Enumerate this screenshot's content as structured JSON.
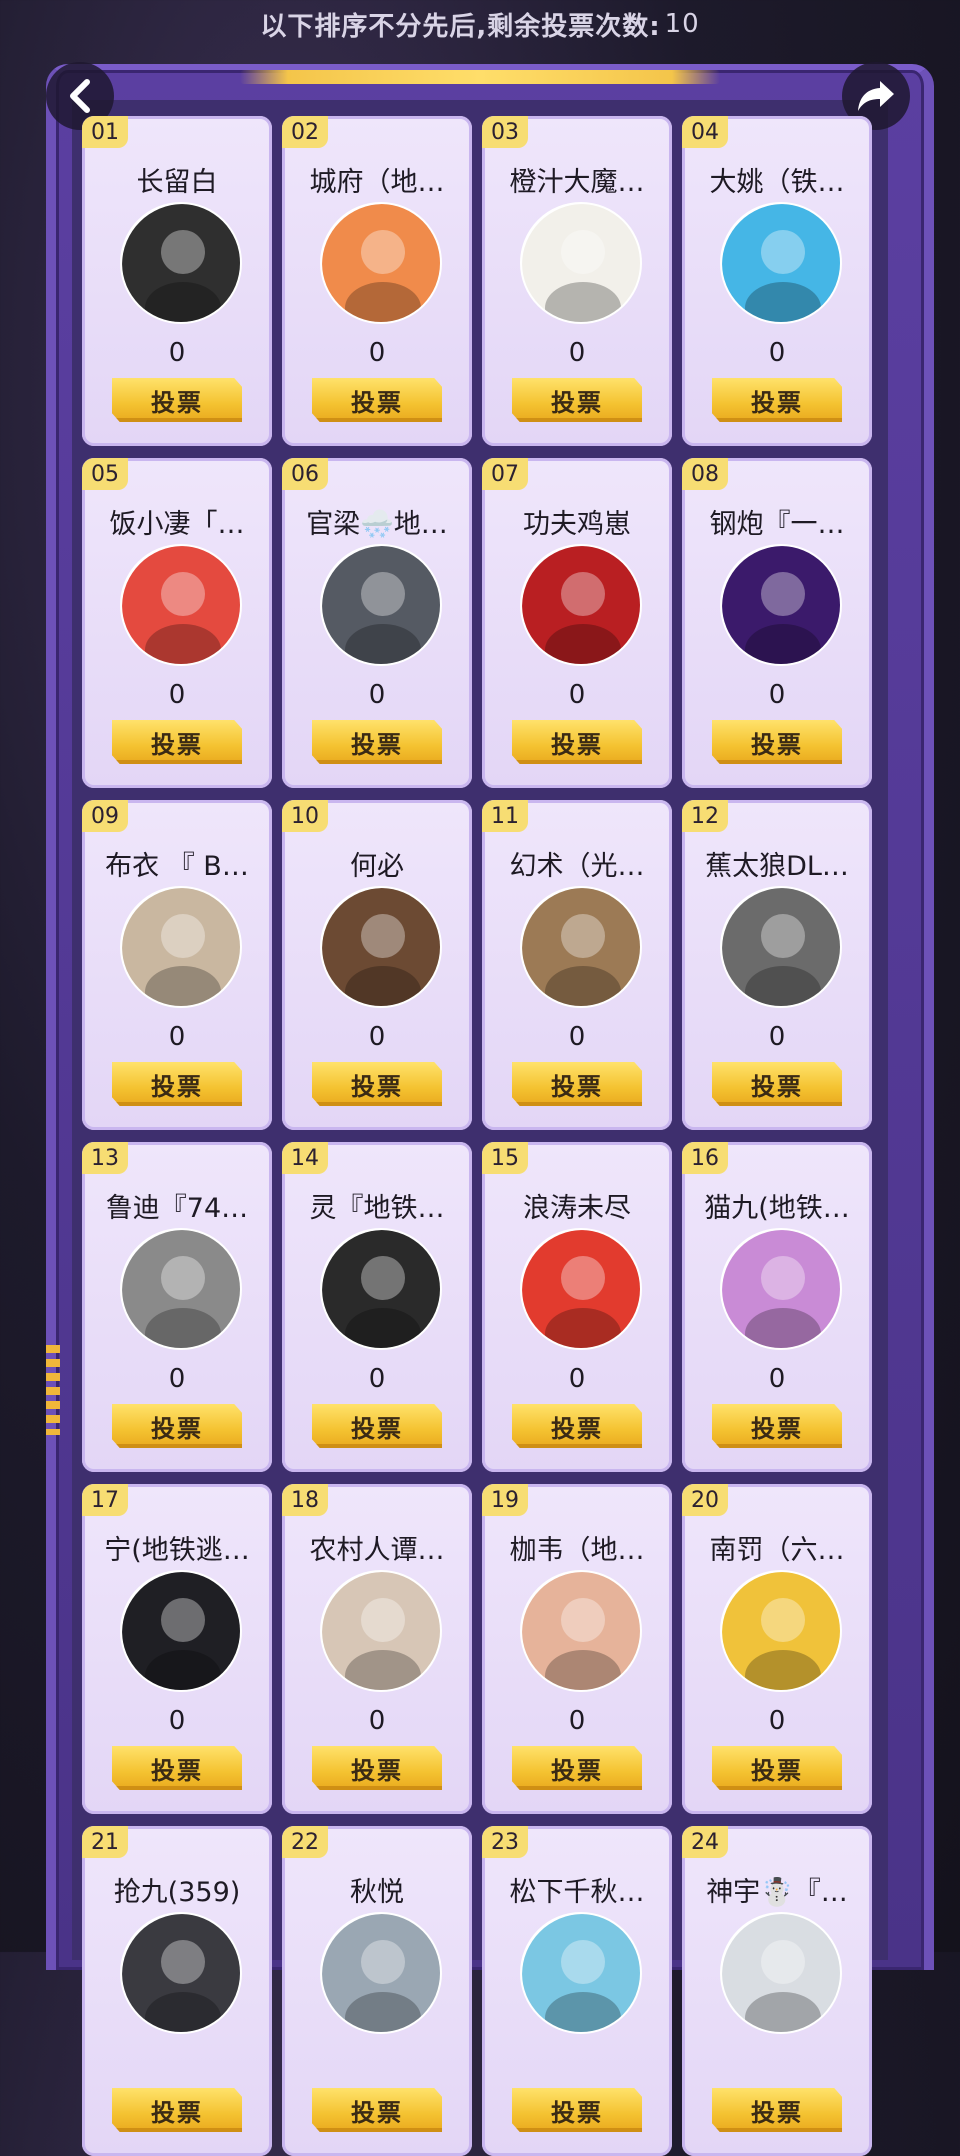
{
  "header": {
    "notice": "以下排序不分先后,剩余投票次数:",
    "remaining_votes": "10"
  },
  "nav": {
    "back_icon": "back-arrow-icon",
    "share_icon": "share-icon"
  },
  "vote_label": "投票",
  "candidates": [
    {
      "num": "01",
      "name": "长留白",
      "votes": "0",
      "avatar_color": "#2f2f2f"
    },
    {
      "num": "02",
      "name": "城府（地…",
      "votes": "0",
      "avatar_color": "#f08b4b"
    },
    {
      "num": "03",
      "name": "橙汁大魔…",
      "votes": "0",
      "avatar_color": "#f2f0ea"
    },
    {
      "num": "04",
      "name": "大姚（铁…",
      "votes": "0",
      "avatar_color": "#45b6e6"
    },
    {
      "num": "05",
      "name": "饭小凄「…",
      "votes": "0",
      "avatar_color": "#e44a3f"
    },
    {
      "num": "06",
      "name": "官梁🌨️地…",
      "votes": "0",
      "avatar_color": "#555a63"
    },
    {
      "num": "07",
      "name": "功夫鸡崽",
      "votes": "0",
      "avatar_color": "#b91f22"
    },
    {
      "num": "08",
      "name": "钢炮『一…",
      "votes": "0",
      "avatar_color": "#3b1a6b"
    },
    {
      "num": "09",
      "name": "布衣 『 B…",
      "votes": "0",
      "avatar_color": "#c9b7a0"
    },
    {
      "num": "10",
      "name": "何必",
      "votes": "0",
      "avatar_color": "#6c4a33"
    },
    {
      "num": "11",
      "name": "幻术（光…",
      "votes": "0",
      "avatar_color": "#9c7a55"
    },
    {
      "num": "12",
      "name": "蕉太狼DL…",
      "votes": "0",
      "avatar_color": "#6b6b6b"
    },
    {
      "num": "13",
      "name": "鲁迪『74…",
      "votes": "0",
      "avatar_color": "#8a8a8a"
    },
    {
      "num": "14",
      "name": "灵『地铁…",
      "votes": "0",
      "avatar_color": "#2a2a2a"
    },
    {
      "num": "15",
      "name": "浪涛未尽",
      "votes": "0",
      "avatar_color": "#e23b2e"
    },
    {
      "num": "16",
      "name": "猫九(地铁…",
      "votes": "0",
      "avatar_color": "#c98bd6"
    },
    {
      "num": "17",
      "name": "宁(地铁逃…",
      "votes": "0",
      "avatar_color": "#1f1f24"
    },
    {
      "num": "18",
      "name": "农村人谭…",
      "votes": "0",
      "avatar_color": "#d7c6b6"
    },
    {
      "num": "19",
      "name": "枷韦（地…",
      "votes": "0",
      "avatar_color": "#e6b39a"
    },
    {
      "num": "20",
      "name": "南罚（六…",
      "votes": "0",
      "avatar_color": "#f0c23a"
    },
    {
      "num": "21",
      "name": "抢九(359)",
      "votes": "",
      "avatar_color": "#3a3a40"
    },
    {
      "num": "22",
      "name": "秋悦",
      "votes": "",
      "avatar_color": "#9aa7b3"
    },
    {
      "num": "23",
      "name": "松下千秋…",
      "votes": "",
      "avatar_color": "#7bc7e3"
    },
    {
      "num": "24",
      "name": "神宇☃️『…",
      "votes": "",
      "avatar_color": "#d9dde2"
    }
  ]
}
